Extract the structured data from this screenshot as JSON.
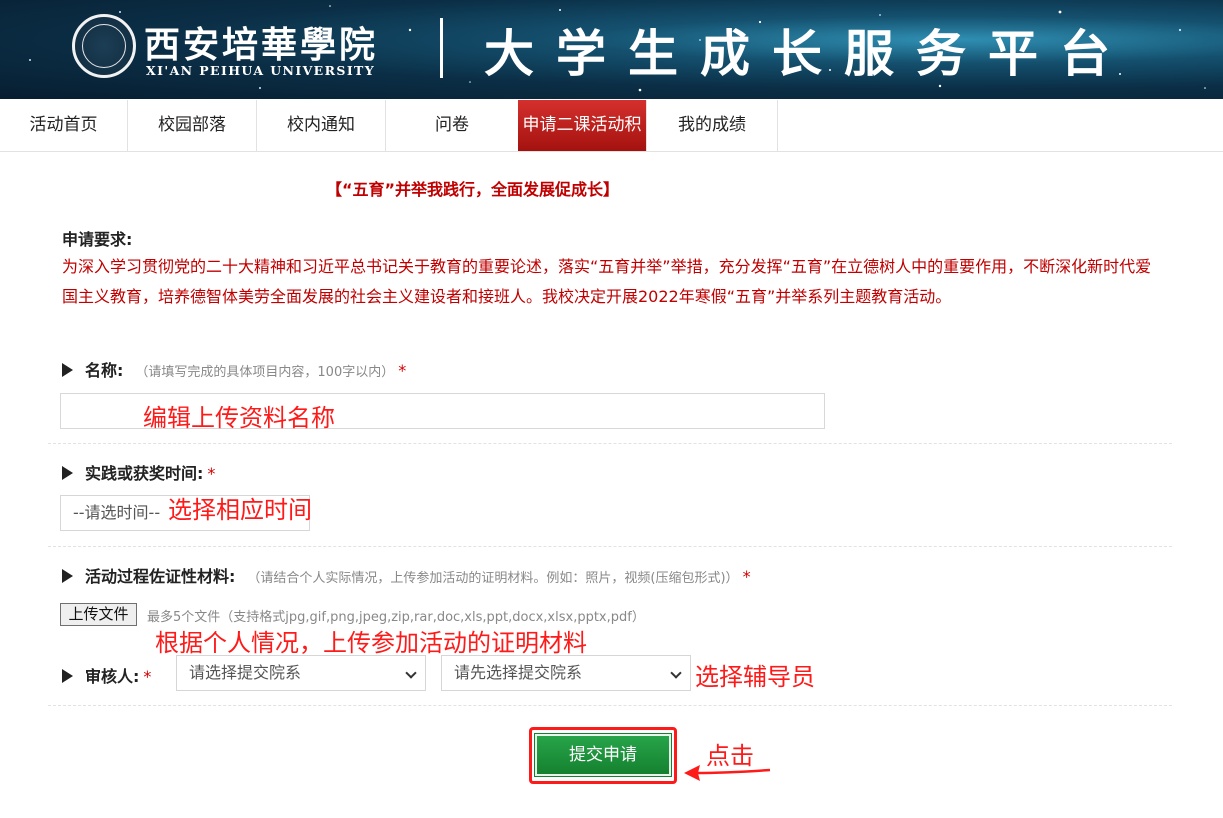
{
  "header": {
    "univ_cn": "西安培華學院",
    "univ_en": "XI'AN PEIHUA UNIVERSITY",
    "platform_title": "大学生成长服务平台"
  },
  "nav": {
    "items": [
      {
        "label": "活动首页"
      },
      {
        "label": "校园部落"
      },
      {
        "label": "校内通知"
      },
      {
        "label": "问卷"
      },
      {
        "label": "申请二课活动积"
      },
      {
        "label": "我的成绩"
      }
    ],
    "active": "申请二课活动积"
  },
  "slogan": "【“五育”并举我践行，全面发展促成长】",
  "requirements": {
    "title": "申请要求:",
    "text": "为深入学习贯彻党的二十大精神和习近平总书记关于教育的重要论述，落实“五育并举”举措，充分发挥“五育”在立德树人中的重要作用，不断深化新时代爱国主义教育，培养德智体美劳全面发展的社会主义建设者和接班人。我校决定开展2022年寒假“五育”并举系列主题教育活动。"
  },
  "form": {
    "name": {
      "label": "名称:",
      "hint": "（请填写完成的具体项目内容，100字以内）",
      "required_mark": "*",
      "value": ""
    },
    "time": {
      "label": "实践或获奖时间:",
      "required_mark": "*",
      "select_value": "--请选时间--"
    },
    "materials": {
      "label": "活动过程佐证性材料:",
      "hint": "（请结合个人实际情况，上传参加活动的证明材料。例如：照片，视频(压缩包形式)）",
      "required_mark": "*",
      "upload_label": "上传文件",
      "upload_hint": "最多5个文件（支持格式jpg,gif,png,jpeg,zip,rar,doc,xls,ppt,docx,xlsx,pptx,pdf）"
    },
    "reviewer": {
      "label": "审核人:",
      "required_mark": "*",
      "department_select": "请选择提交院系",
      "counselor_select": "请先选择提交院系"
    },
    "submit_label": "提交申请"
  },
  "annotations": {
    "name": "编辑上传资料名称",
    "time": "选择相应时间",
    "materials": "根据个人情况，上传参加活动的证明材料",
    "reviewer": "选择辅导员",
    "submit": "点击"
  },
  "colors": {
    "nav_active": "#b81c1a",
    "requirement_text": "#c00000",
    "annotation": "#ff1a1a",
    "submit": "#1f9440"
  }
}
